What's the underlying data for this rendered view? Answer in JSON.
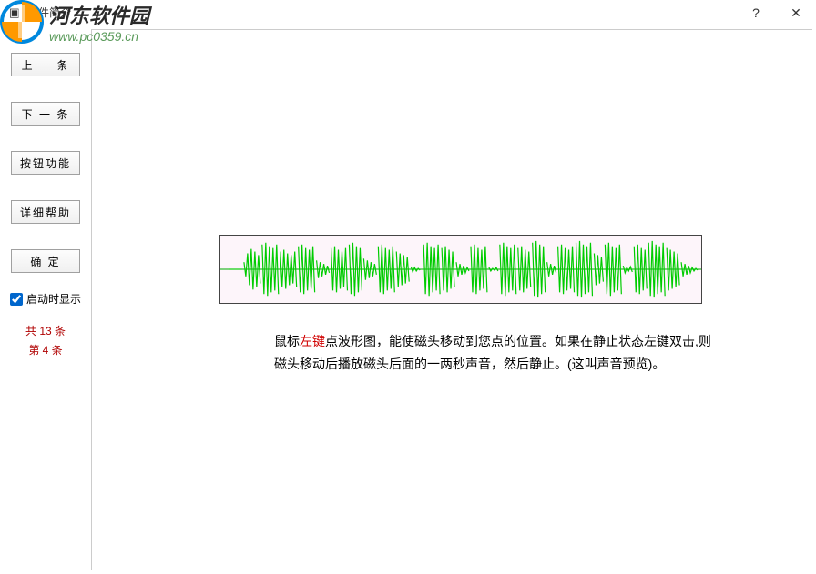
{
  "window": {
    "title": "软件简介",
    "help": "?",
    "close": "✕"
  },
  "sidebar": {
    "prev": "上 一 条",
    "next": "下 一 条",
    "button_func": "按钮功能",
    "detail_help": "详细帮助",
    "ok": "确  定",
    "show_on_start": "启动时显示",
    "total": "共 13 条",
    "current": "第 4 条"
  },
  "help": {
    "prefix": "鼠标",
    "highlight": "左键",
    "text1": "点波形图，能使磁头移动到您点的位置。如果在静止状态左键双击,则",
    "text2": "磁头移动后播放磁头后面的一两秒声音，然后静止。(这叫声音预览)。"
  },
  "watermark": {
    "title": "河东软件园",
    "url": "www.pc0359.cn"
  }
}
